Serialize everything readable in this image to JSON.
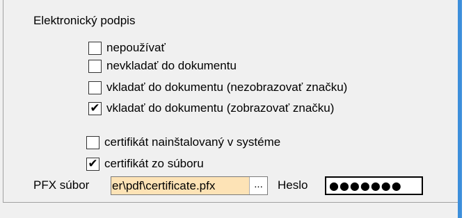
{
  "signature": {
    "title": "Elektronický podpis",
    "options": [
      {
        "label": "nepoužívať",
        "checked": false
      },
      {
        "label": "nevkladať do dokumentu",
        "checked": false
      },
      {
        "label": "vkladať do dokumentu (nezobrazovať značku)",
        "checked": false
      },
      {
        "label": "vkladať do dokumentu (zobrazovať značku)",
        "checked": true
      }
    ],
    "check_mark": "✔",
    "empty_mark": ""
  },
  "certificate": {
    "options": [
      {
        "label": "certifikát nainštalovaný v systéme",
        "checked": false
      },
      {
        "label": "certifikát zo súboru",
        "checked": true
      }
    ]
  },
  "pfx": {
    "label": "PFX súbor",
    "value": "er\\pdf\\certificate.pfx",
    "browse_label": "...",
    "field_color": "#fde3b6"
  },
  "password": {
    "label": "Heslo",
    "masked_value": "●●●●●●●"
  },
  "colors": {
    "accent": "#3d8fdb",
    "panel_background": "#f0f0f0"
  }
}
